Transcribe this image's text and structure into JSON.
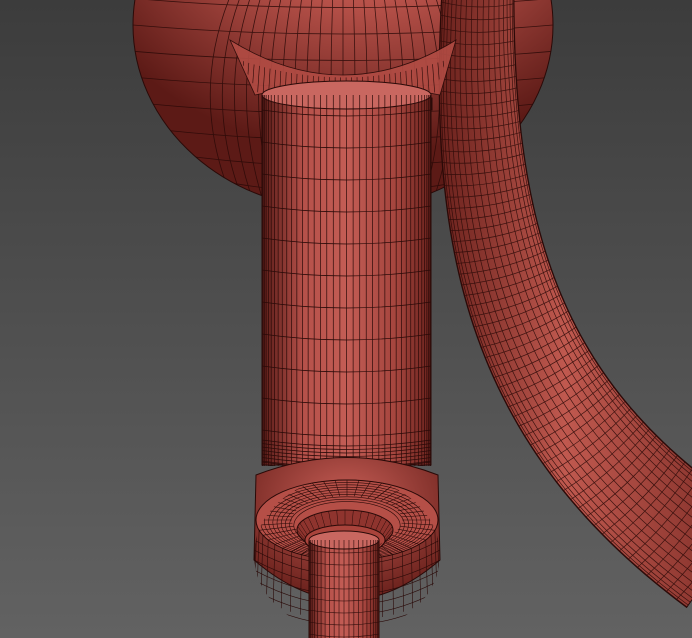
{
  "viewport": {
    "background_top": "#3c3c3c",
    "background_bottom": "#626262"
  },
  "model": {
    "base_color": "#a9433b",
    "highlight_color": "#e0847b",
    "shadow_color": "#4a1512",
    "wire_color": "#2a0a08",
    "parts": [
      {
        "name": "bulb"
      },
      {
        "name": "collar"
      },
      {
        "name": "main-cylinder"
      },
      {
        "name": "base-ring"
      },
      {
        "name": "inner-step"
      },
      {
        "name": "stem"
      },
      {
        "name": "curved-tube"
      }
    ]
  }
}
